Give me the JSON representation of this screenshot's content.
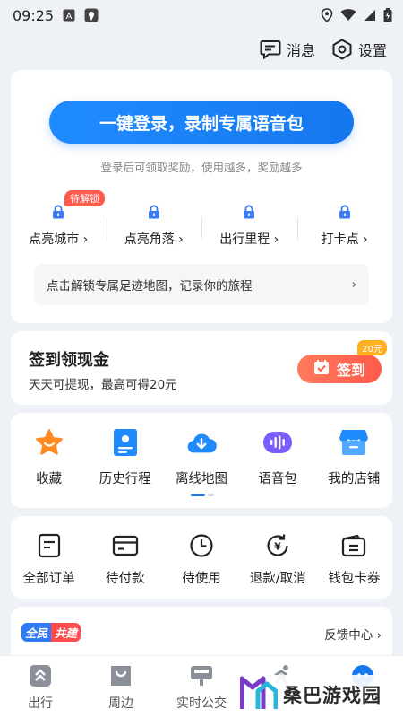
{
  "status_bar": {
    "time": "09:25"
  },
  "top_actions": {
    "messages": "消息",
    "settings": "设置"
  },
  "login": {
    "button": "一键登录，录制专属语音包",
    "hint": "登录后可领取奖励，使用越多，奖励越多",
    "badge": "待解锁",
    "stats": [
      {
        "label": "点亮城市 ›"
      },
      {
        "label": "点亮角落 ›"
      },
      {
        "label": "出行里程 ›"
      },
      {
        "label": "打卡点 ›"
      }
    ],
    "footprint": "点击解锁专属足迹地图，记录你的旅程",
    "footprint_chevron": "›"
  },
  "signin": {
    "title": "签到领现金",
    "subtitle": "天天可提现，最高可得20元",
    "button": "签到",
    "badge": "20元"
  },
  "tools": [
    {
      "label": "收藏",
      "icon": "star-icon",
      "color": "#ff8a1f"
    },
    {
      "label": "历史行程",
      "icon": "history-trip-icon",
      "color": "#1f8bff"
    },
    {
      "label": "离线地图",
      "icon": "cloud-download-icon",
      "color": "#1f8bff"
    },
    {
      "label": "语音包",
      "icon": "voice-icon",
      "color": "#7b5cff"
    },
    {
      "label": "我的店铺",
      "icon": "shop-icon",
      "color": "#1f8bff"
    }
  ],
  "orders": [
    {
      "label": "全部订单",
      "icon": "orders-icon"
    },
    {
      "label": "待付款",
      "icon": "card-icon"
    },
    {
      "label": "待使用",
      "icon": "clock-icon"
    },
    {
      "label": "退款/取消",
      "icon": "refund-icon"
    },
    {
      "label": "钱包卡券",
      "icon": "wallet-icon"
    }
  ],
  "feedback": {
    "cobuild_a": "全民",
    "cobuild_b": "共建",
    "link": "反馈中心 ›"
  },
  "tabbar": [
    {
      "label": "出行",
      "icon": "travel-icon"
    },
    {
      "label": "周边",
      "icon": "nearby-icon"
    },
    {
      "label": "实时公交",
      "icon": "bus-icon"
    },
    {
      "label": "",
      "icon": "running-icon"
    },
    {
      "label": "",
      "icon": "profile-icon"
    }
  ],
  "watermark": {
    "text": "桑巴游戏园"
  },
  "colors": {
    "accent": "#1677ee",
    "danger": "#ff5a4a",
    "background": "#eef1f5"
  }
}
